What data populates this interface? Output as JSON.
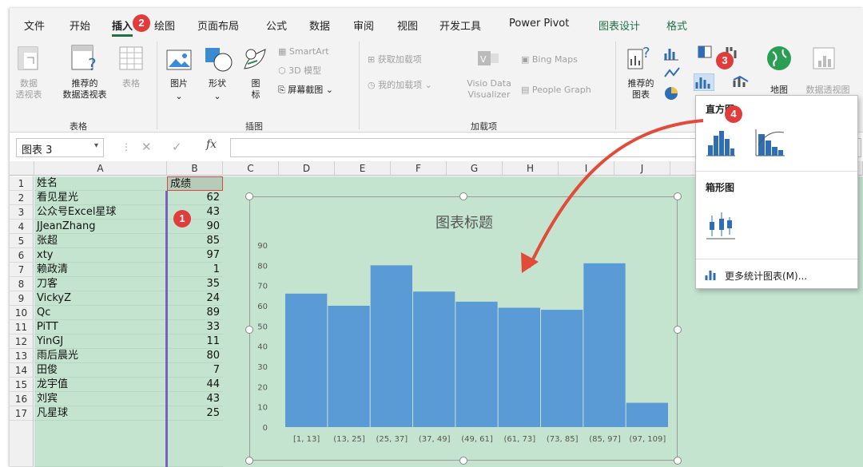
{
  "tabs": [
    "文件",
    "开始",
    "插入",
    "绘图",
    "页面布局",
    "公式",
    "数据",
    "审阅",
    "视图",
    "开发工具",
    "Power Pivot",
    "图表设计",
    "格式"
  ],
  "ribbon": {
    "tables": {
      "pivot": "数据\n透视表",
      "recommended_pivot": "推荐的\n数据透视表",
      "table": "表格",
      "group": "表格"
    },
    "illustrations": {
      "picture": "图片",
      "shapes": "形状",
      "icons": "图\n标",
      "smartart": "SmartArt",
      "model3d": "3D 模型",
      "screenshot": "屏幕截图",
      "group": "插图"
    },
    "addins": {
      "get": "获取加载项",
      "my": "我的加载项",
      "visio": "Visio Data\nVisualizer",
      "bing": "Bing Maps",
      "people": "People Graph",
      "group": "加载项"
    },
    "charts": {
      "recommended": "推荐的\n图表",
      "map": "地图",
      "pivotchart": "数据透视图"
    }
  },
  "namebox": "图表 3",
  "fx_label": "fx",
  "columns": [
    "A",
    "B",
    "C",
    "D",
    "E",
    "F",
    "G",
    "H",
    "I",
    "J"
  ],
  "rows": [
    {
      "n": "1",
      "a": "姓名",
      "b": "成绩"
    },
    {
      "n": "2",
      "a": "看见星光",
      "b": "62"
    },
    {
      "n": "3",
      "a": "公众号Excel星球",
      "b": "43"
    },
    {
      "n": "4",
      "a": "JJeanZhang",
      "b": "90"
    },
    {
      "n": "5",
      "a": "张超",
      "b": "85"
    },
    {
      "n": "6",
      "a": "xty",
      "b": "97"
    },
    {
      "n": "7",
      "a": "赖政清",
      "b": "1"
    },
    {
      "n": "8",
      "a": "刀客",
      "b": "35"
    },
    {
      "n": "9",
      "a": "VickyZ",
      "b": "24"
    },
    {
      "n": "10",
      "a": "Qc",
      "b": "89"
    },
    {
      "n": "11",
      "a": "PiTT",
      "b": "33"
    },
    {
      "n": "12",
      "a": "YinGJ",
      "b": "11"
    },
    {
      "n": "13",
      "a": "雨后晨光",
      "b": "80"
    },
    {
      "n": "14",
      "a": "田俊",
      "b": "7"
    },
    {
      "n": "15",
      "a": "龙宇值",
      "b": "44"
    },
    {
      "n": "16",
      "a": "刘宾",
      "b": "43"
    },
    {
      "n": "17",
      "a": "凡星球",
      "b": "25"
    }
  ],
  "chart_data": {
    "type": "bar",
    "title": "图表标题",
    "categories": [
      "[1, 13]",
      "(13, 25]",
      "(25, 37]",
      "(37, 49]",
      "(49, 61]",
      "(61, 73]",
      "(73, 85]",
      "(85, 97]",
      "(97, 109]"
    ],
    "values": [
      66,
      60,
      80,
      67,
      62,
      59,
      58,
      81,
      12
    ],
    "ylim": [
      0,
      90
    ],
    "yticks": [
      "0",
      "10",
      "20",
      "30",
      "40",
      "50",
      "60",
      "70",
      "80",
      "90"
    ],
    "bar_color": "#5b9bd5",
    "bg_color": "#c5e4d0"
  },
  "dropdown": {
    "histogram_title": "直方图",
    "box_title": "箱形图",
    "more": "更多统计图表(M)..."
  },
  "badges": [
    "1",
    "2",
    "3",
    "4"
  ],
  "colors": {
    "accent": "#1e7145",
    "badge": "#e03c3c",
    "arrow": "#e04b3a"
  }
}
